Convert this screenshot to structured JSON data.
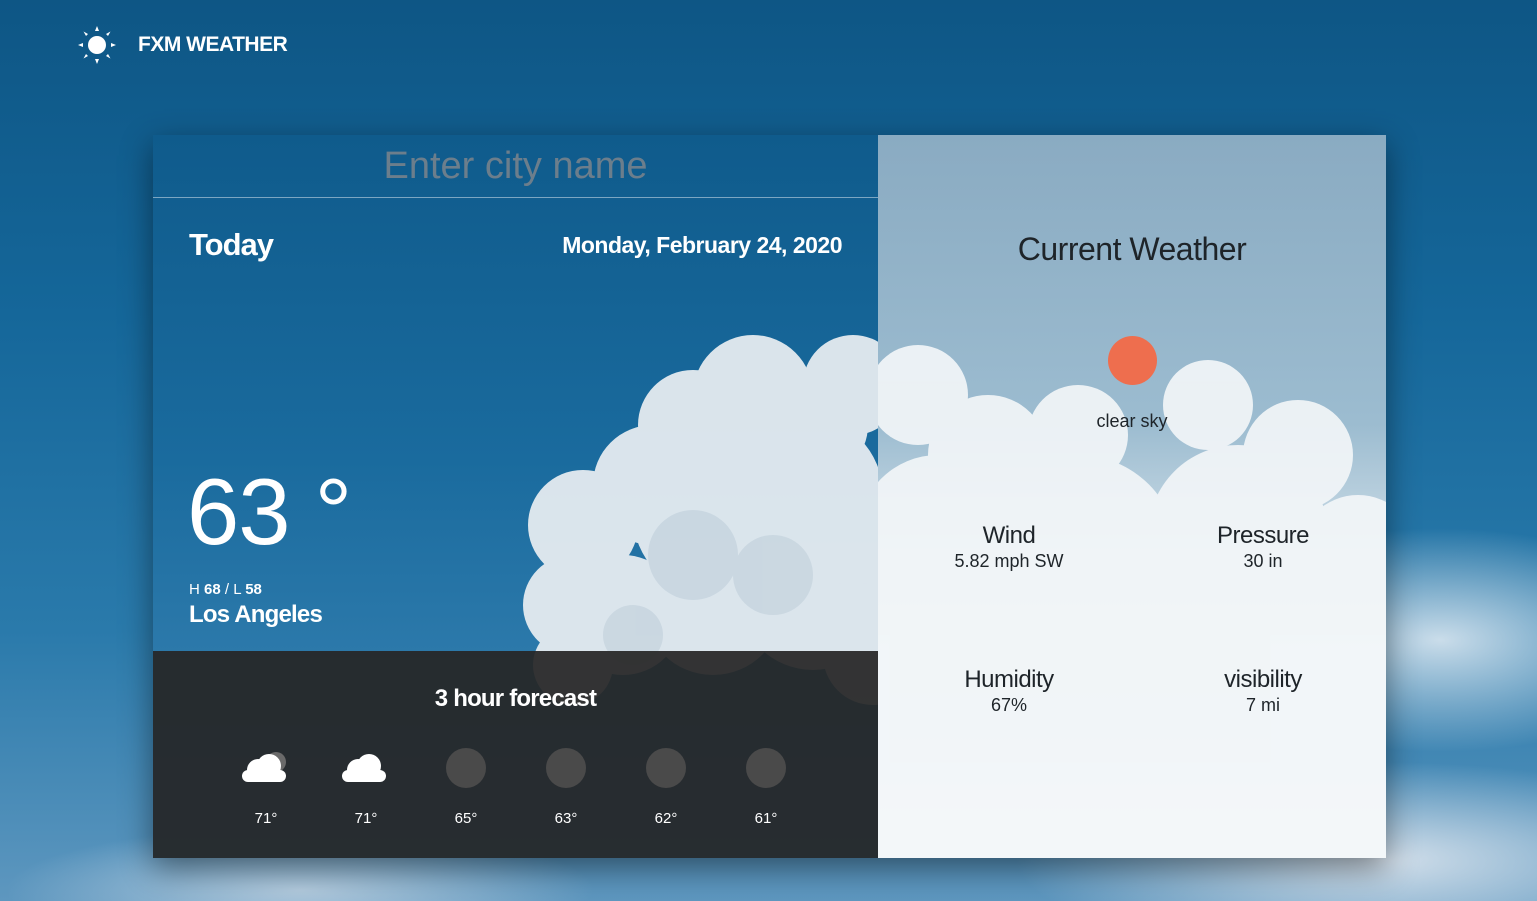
{
  "app": {
    "brand_name": "FXM WEATHER",
    "brand_icon": "sun-icon"
  },
  "search": {
    "placeholder": "Enter city name",
    "value": ""
  },
  "today": {
    "label": "Today",
    "date": "Monday, February 24, 2020",
    "temperature": "63 °",
    "high_prefix": "H",
    "high": "68",
    "low_prefix": "L",
    "low": "58",
    "separator": "/",
    "city": "Los Angeles"
  },
  "forecast": {
    "title": "3 hour forecast",
    "items": [
      {
        "temp": "71°",
        "icon": "cloud-icon"
      },
      {
        "temp": "71°",
        "icon": "cloud-icon"
      },
      {
        "temp": "65°",
        "icon": "circle-icon"
      },
      {
        "temp": "63°",
        "icon": "circle-icon"
      },
      {
        "temp": "62°",
        "icon": "circle-icon"
      },
      {
        "temp": "61°",
        "icon": "circle-icon"
      }
    ]
  },
  "current": {
    "title": "Current Weather",
    "icon": "sun-dot-icon",
    "description": "clear sky",
    "wind_label": "Wind",
    "wind_value": "5.82 mph SW",
    "pressure_label": "Pressure",
    "pressure_value": "30 in",
    "humidity_label": "Humidity",
    "humidity_value": "67%",
    "visibility_label": "visibility",
    "visibility_value": "7 mi"
  },
  "colors": {
    "sun_dot": "#ee6e4e",
    "forecast_bg": "#262626",
    "sky_top": "#0e5685"
  }
}
